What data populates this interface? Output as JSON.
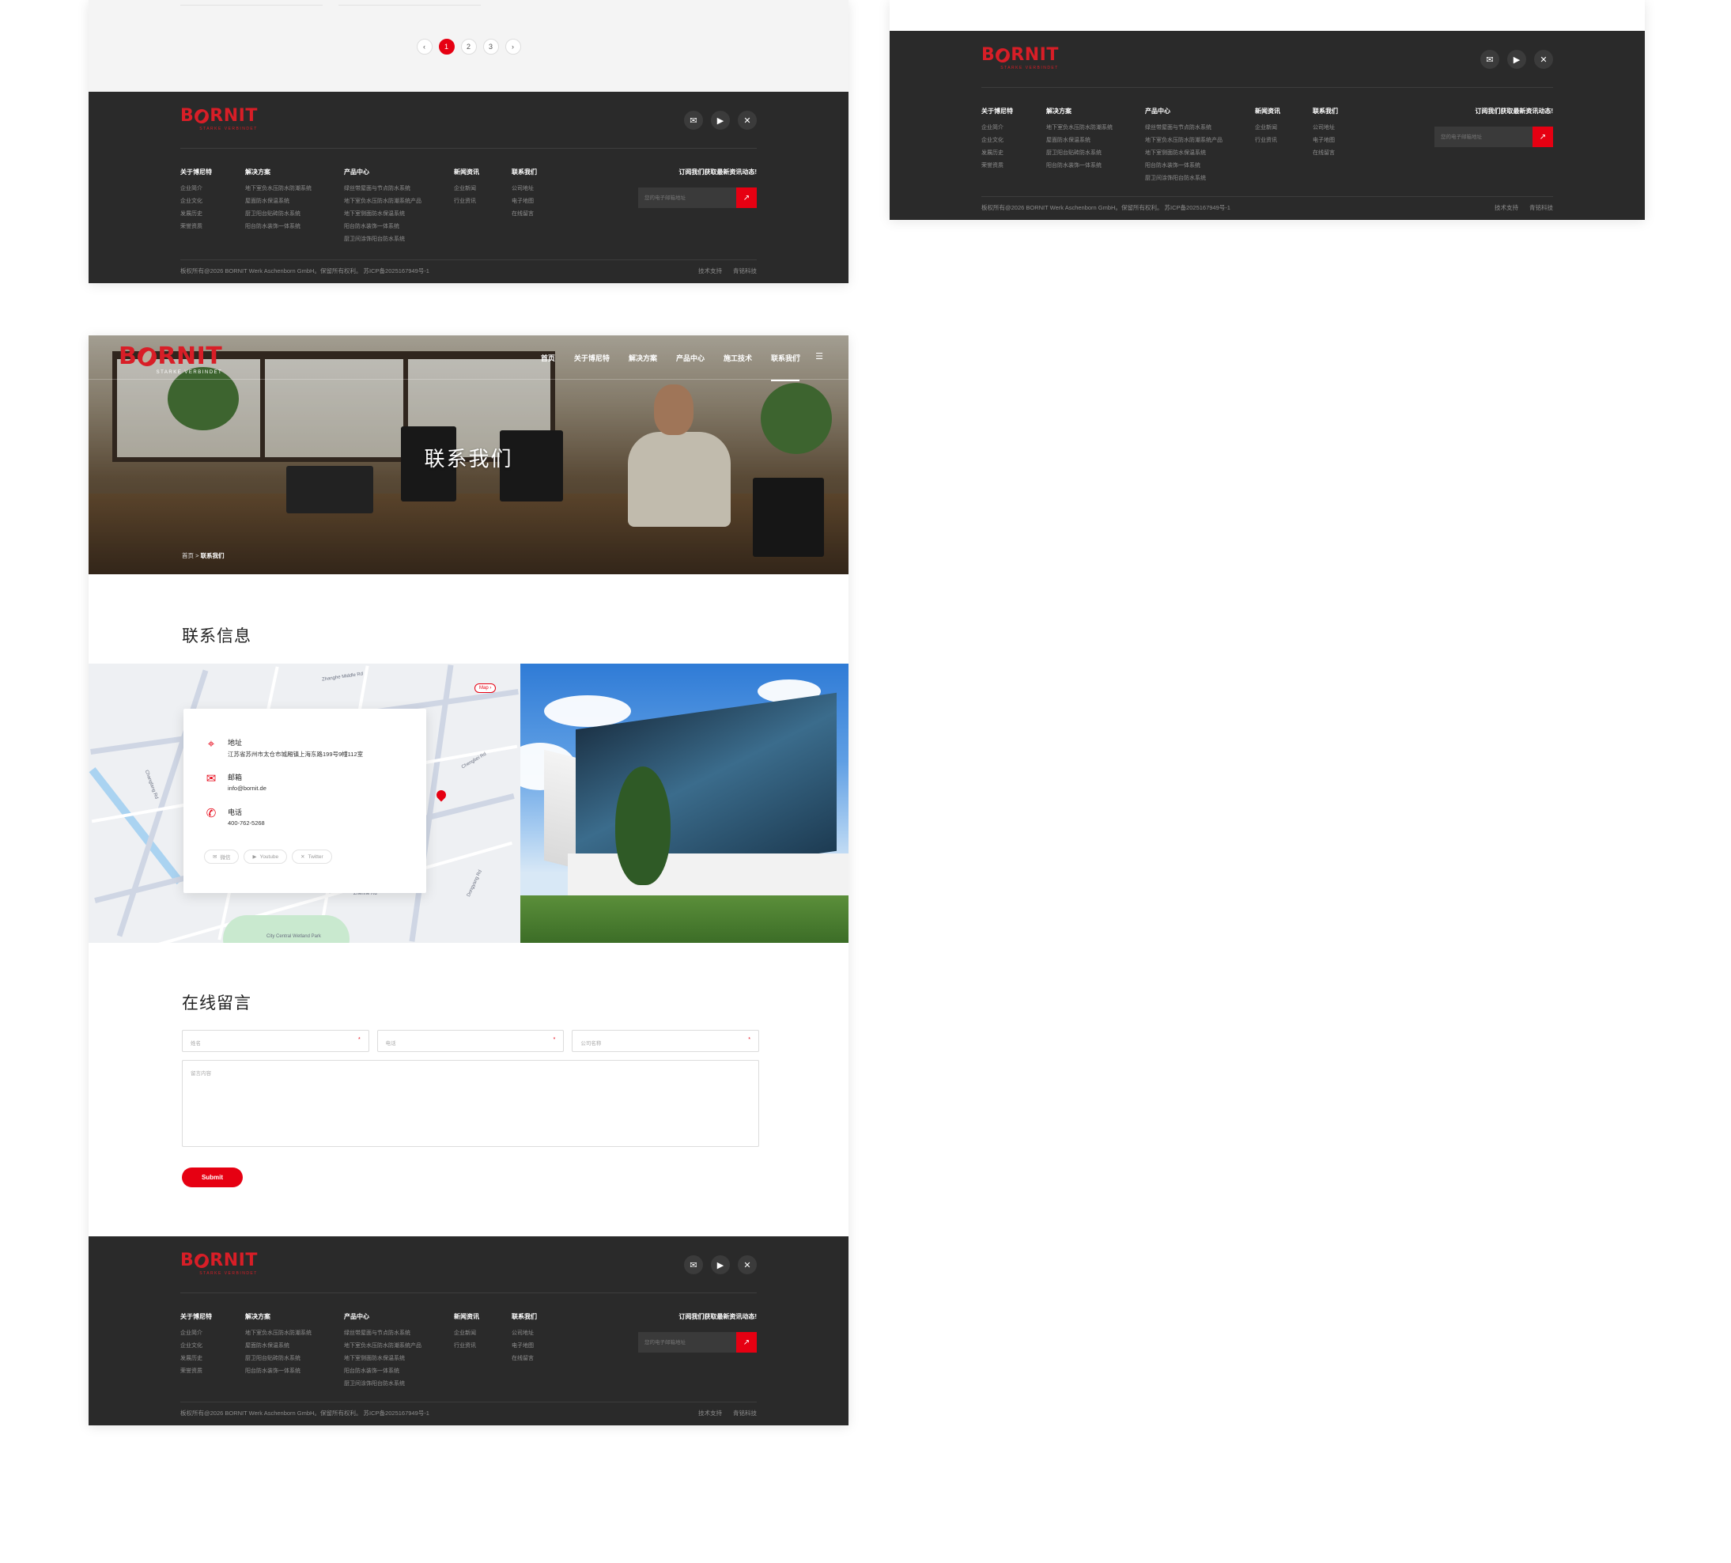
{
  "brand": {
    "logo_text_left": "B",
    "logo_text_right": "RNIT",
    "tagline": "STARKE VERBINDET"
  },
  "pagination": {
    "prev": "‹",
    "pages": [
      "1",
      "2",
      "3"
    ],
    "next": "›",
    "current": "1"
  },
  "footer": {
    "social": [
      {
        "icon": "wechat-icon",
        "glyph": "✉"
      },
      {
        "icon": "youtube-icon",
        "glyph": "▶"
      },
      {
        "icon": "x-twitter-icon",
        "glyph": "✕"
      }
    ],
    "columns": [
      {
        "title": "关于博尼特",
        "items": [
          "企业简介",
          "企业文化",
          "发展历史",
          "荣誉资质"
        ]
      },
      {
        "title": "解决方案",
        "items": [
          "地下室负水压防水防潮系统",
          "屋面防水保温系统",
          "厨卫阳台贴砖防水系统",
          "阳台防水装饰一体系统"
        ]
      },
      {
        "title": "产品中心",
        "items": [
          "绿丝带屋面与节点防水系统",
          "地下室负水压防水防潮系统产品",
          "地下室侧面防水保温系统",
          "阳台防水装饰一体系统",
          "厨卫间涂饰阳台防水系统"
        ]
      },
      {
        "title": "新闻资讯",
        "items": [
          "企业新闻",
          "行业资讯"
        ]
      },
      {
        "title": "联系我们",
        "items": [
          "公司地址",
          "电子地图",
          "在线留言"
        ]
      }
    ],
    "subscribe_title": "订阅我们获取最新资讯动态!",
    "subscribe_placeholder": "您的电子邮箱地址",
    "subscribe_button": "↗",
    "copyright": "板权所有@2026 BORNIT Werk Aschenborn GmbH。保留所有权利。    苏ICP备2025167949号-1",
    "links": [
      "技术支持",
      "青铭科技"
    ]
  },
  "nav": {
    "items": [
      "首页",
      "关于博尼特",
      "解决方案",
      "产品中心",
      "施工技术",
      "联系我们"
    ],
    "active": "联系我们",
    "search_icon": "⌕",
    "menu_icon": "☰"
  },
  "hero": {
    "title": "联系我们",
    "crumb_home": "首页",
    "crumb_sep": " > ",
    "crumb_current": "联系我们"
  },
  "contact": {
    "title": "联系信息",
    "map_button": "Map ›",
    "address_label": "地址",
    "address_value": "江苏省苏州市太仓市城厢镇上海东路199号9幢112室",
    "email_label": "邮箱",
    "email_value": "info@bornit.de",
    "phone_label": "电话",
    "phone_value": "400-762-5268",
    "chips": [
      "微信",
      "Youtube",
      "Twitter"
    ],
    "map_labels": [
      "Zhanghe Middle Rd",
      "Changlang Rd",
      "Chengbei Rd",
      "Zhenhe Rd",
      "Dongyang Rd",
      "City Central Wetland Park"
    ]
  },
  "form": {
    "title": "在线留言",
    "name_placeholder": "姓名",
    "phone_placeholder": "电话",
    "company_placeholder": "公司名称",
    "required_mark": "*",
    "message_placeholder": "留言内容",
    "submit": "Submit"
  },
  "colors": {
    "accent": "#e60012",
    "footer_bg": "#2a2a2a",
    "logo_red": "#d81e27"
  }
}
